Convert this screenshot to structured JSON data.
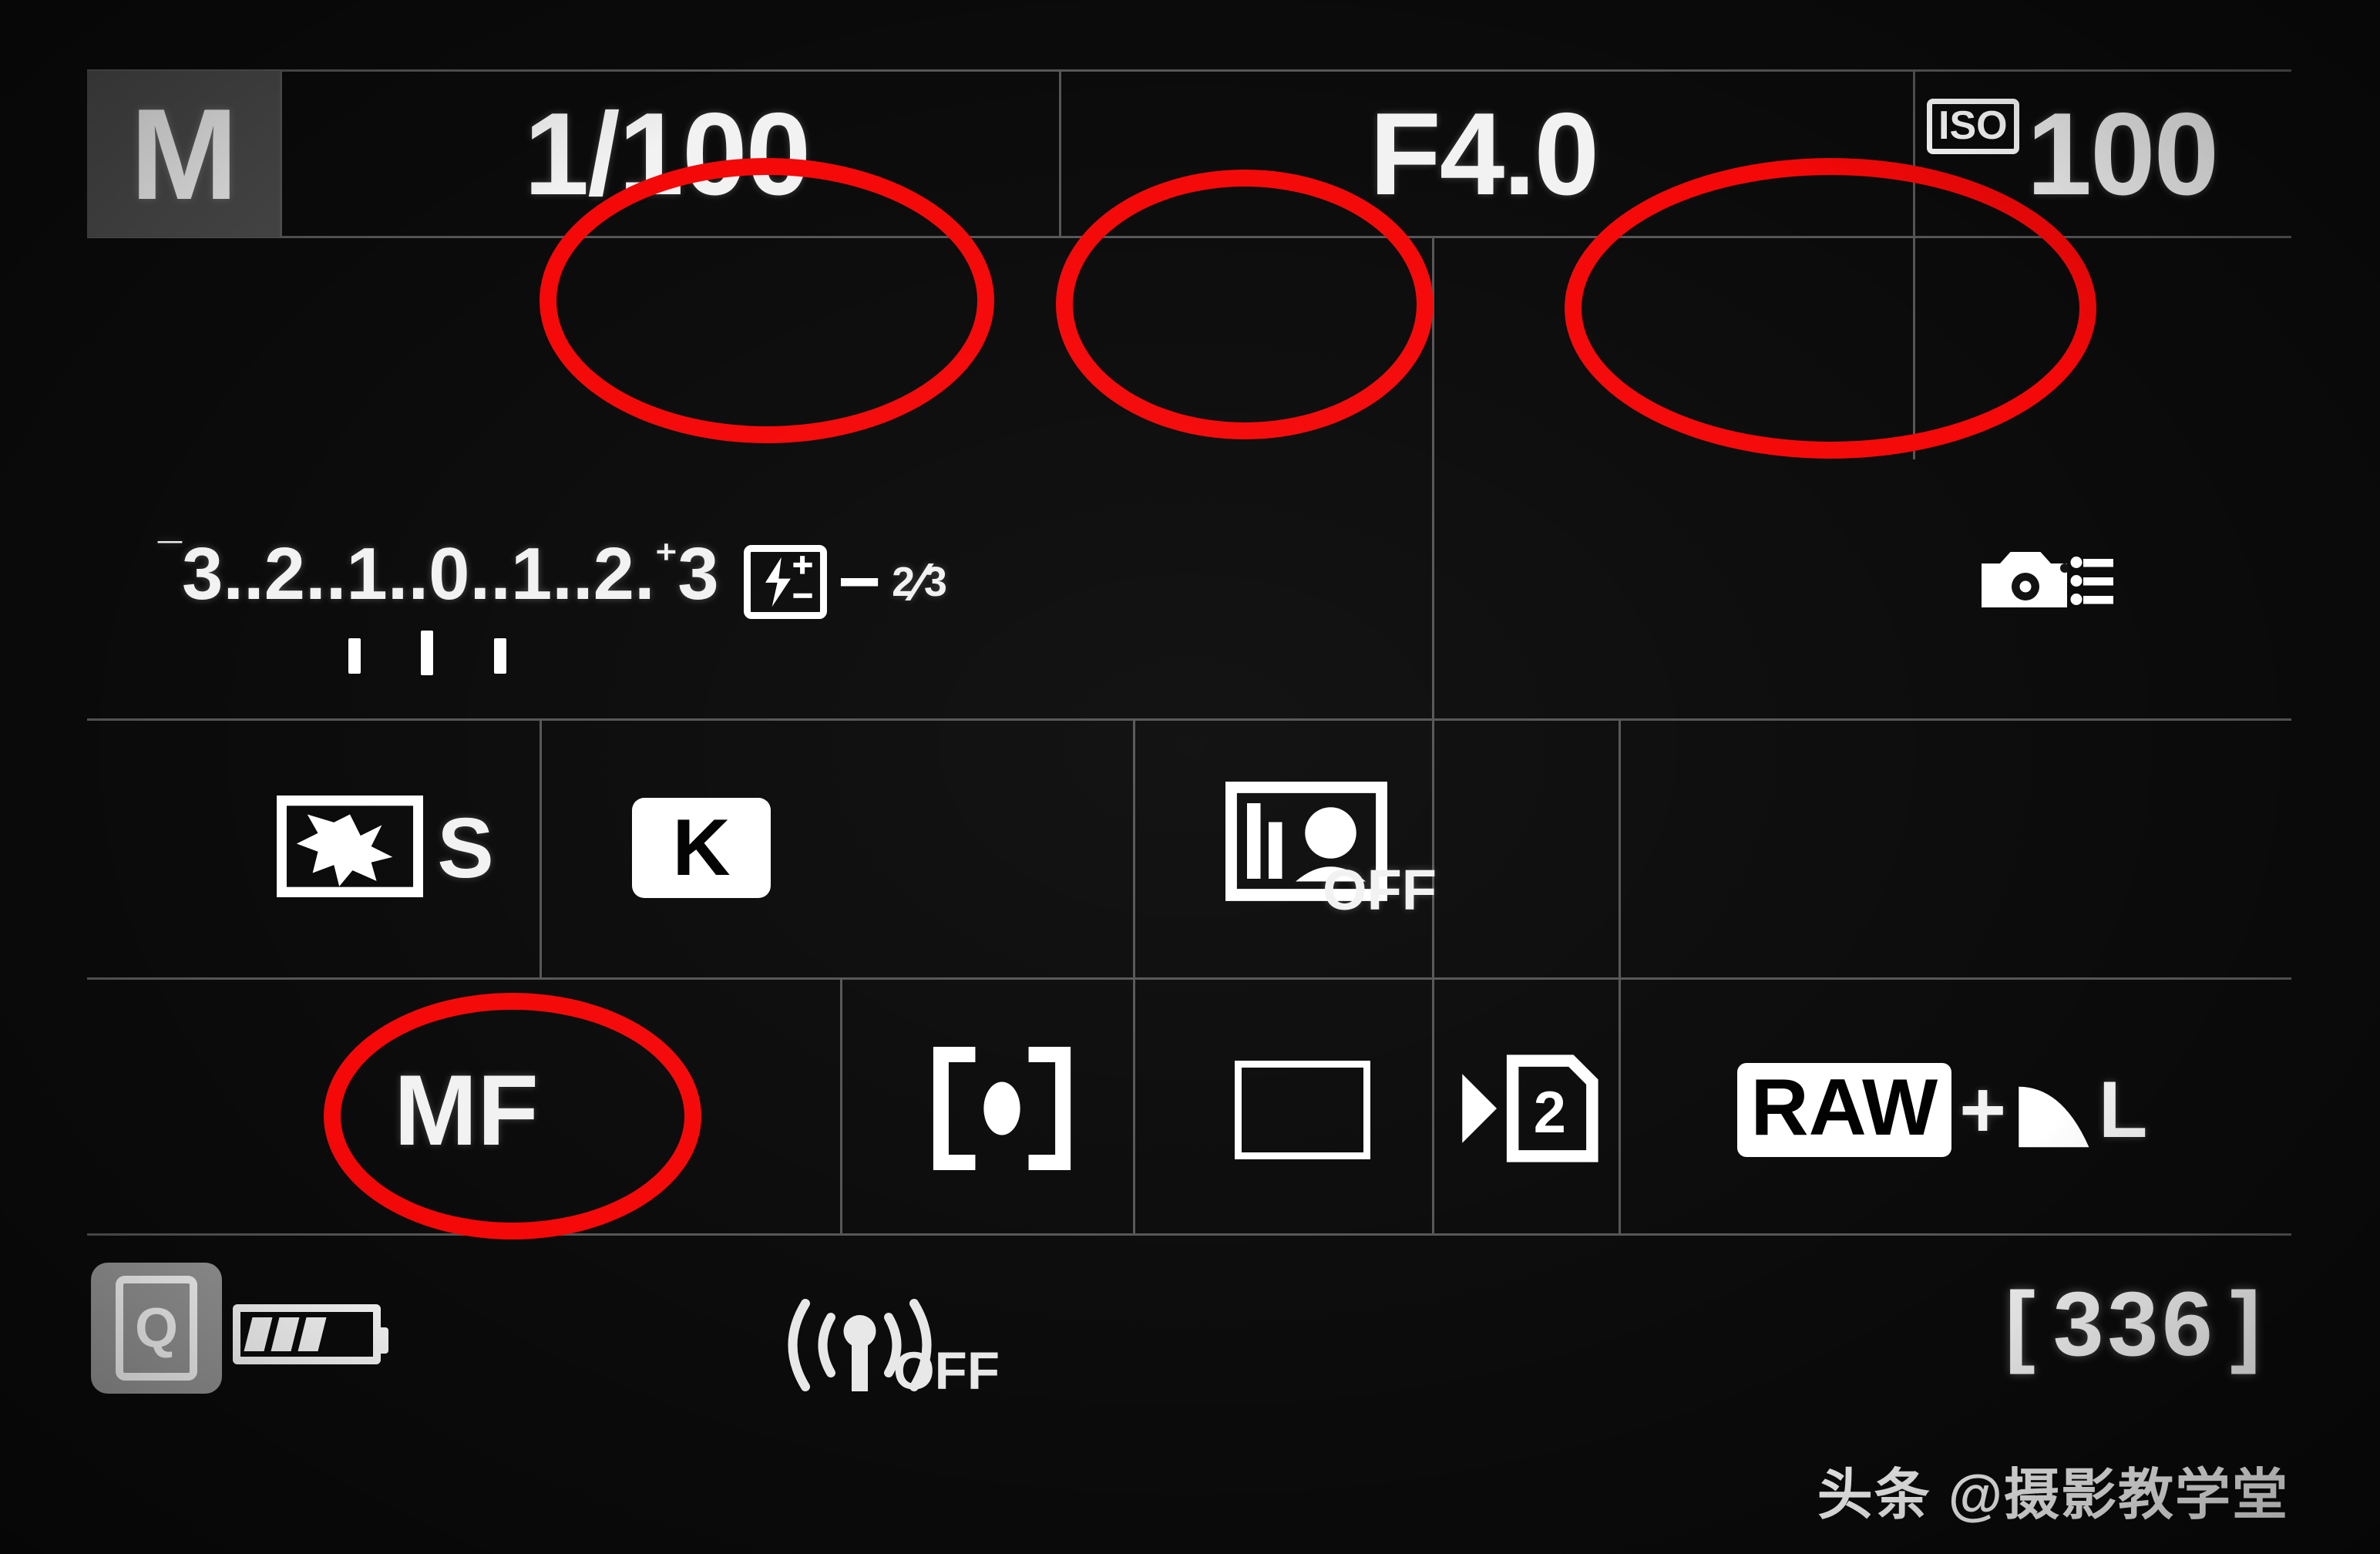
{
  "device": {
    "screen_name": "camera-quick-control-display",
    "background_color": "#0b0b0b",
    "text_color": "#f2f2f2",
    "annotation_color": "#f50808",
    "highlight_color": "#4a4a4a"
  },
  "row_exposure": {
    "shooting_mode": "M",
    "shutter_speed": "1/100",
    "aperture": "F4.0",
    "iso_label": "ISO",
    "iso_value": "100"
  },
  "row_meter": {
    "scale_text": "3..2..1..0..1..2..3",
    "minus_sign": "¯",
    "plus_sign": "⁺",
    "scale_left": "3",
    "scale_mid_left_1": "2",
    "scale_mid_left_2": "1",
    "scale_center": "0",
    "scale_mid_right_1": "1",
    "scale_mid_right_2": "2",
    "scale_right": "3",
    "flash_exposure_compensation": "−",
    "flash_comp_numerator": "2",
    "flash_comp_denominator": "3",
    "flash_comp_icon": "flash-plus-minus-icon",
    "camera_settings_icon": "camera-settings-icon"
  },
  "row_settings": {
    "white_balance_bracket": "S",
    "white_balance_icon": "wb-shift-bracket-icon",
    "color_temperature": "K",
    "picture_style_state": "OFF",
    "picture_style_icon": "picture-style-icon"
  },
  "row_focus": {
    "focus_mode": "MF",
    "metering_mode_icon": "spot-metering-icon",
    "af_area_icon": "single-point-af-icon",
    "drive_mode": "2",
    "drive_mode_icon": "self-timer-icon",
    "image_quality": "RAW",
    "image_quality_plus": "+",
    "image_quality_jpeg": "L",
    "image_quality_jpeg_icon": "fine-quality-icon"
  },
  "status_bar": {
    "quick_menu_label": "Q",
    "battery_icon": "battery-icon",
    "battery_bars": 3,
    "wifi_label": "OFF",
    "wifi_icon": "wifi-icon",
    "shots_remaining": "336",
    "shots_open_bracket": "[",
    "shots_close_bracket": "]",
    "watermark": "头条 @摄影教学堂"
  },
  "annotations": {
    "circled_items": [
      "shutter_speed",
      "aperture",
      "iso_value",
      "focus_mode"
    ]
  }
}
